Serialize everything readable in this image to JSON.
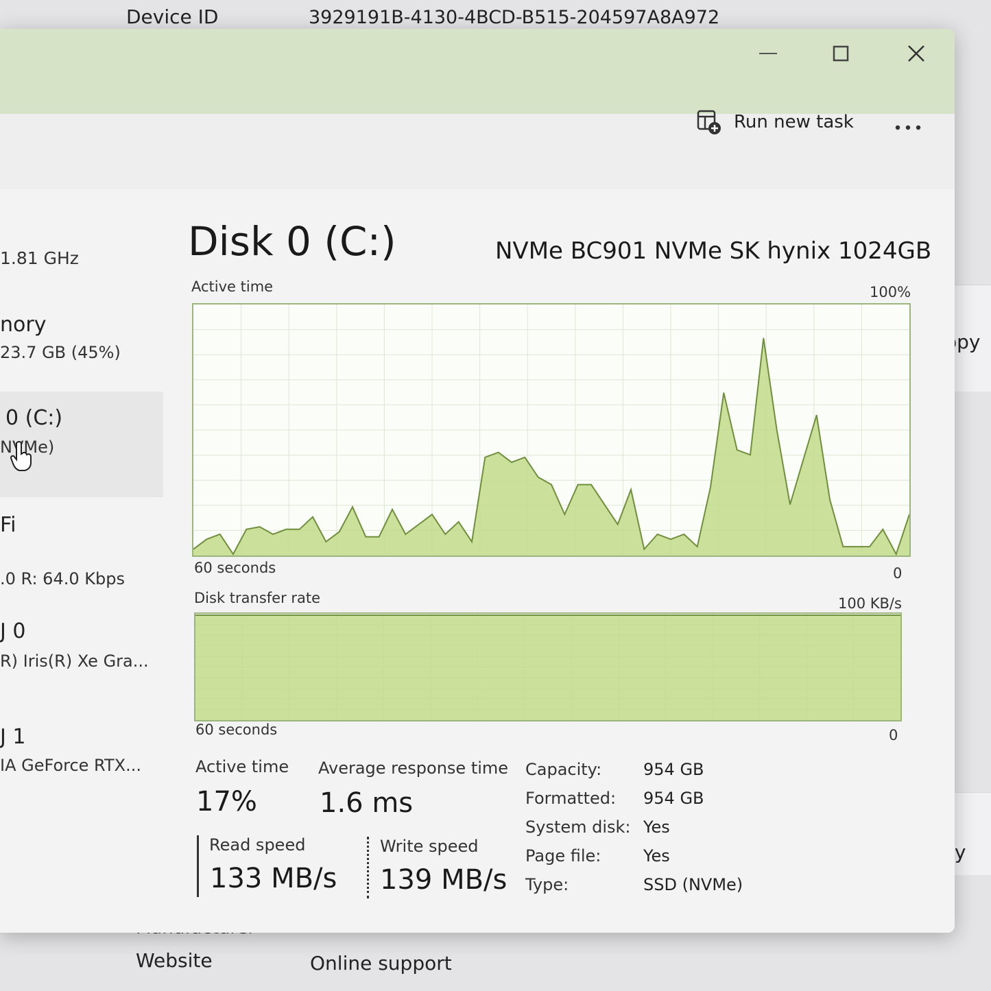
{
  "background_page": {
    "device_id_label": "Device ID",
    "device_id_value": "3929191B-4130-4BCD-B515-204597A8A972",
    "manufacturer_label": "Manufacturer",
    "website_label": "Website",
    "website_value": "Online support",
    "copy_label_1": "opy",
    "copy_label_2": "opy"
  },
  "window": {
    "buttons": {
      "minimize": "minimize",
      "maximize": "maximize",
      "close": "close"
    }
  },
  "toolbar": {
    "run_new_task": "Run new task",
    "more": "..."
  },
  "sidebar": {
    "cpu_speed": "1.81 GHz",
    "memory_title": "nory",
    "memory_usage": "23.7 GB (45%)",
    "disk_title": "0 (C:)",
    "disk_sub": "NVMe)",
    "wifi_title": "Fi",
    "wifi_sub": ".0 R: 64.0 Kbps",
    "gpu0_title": "J 0",
    "gpu0_sub": "R) Iris(R) Xe Gra...",
    "gpu1_title": "J 1",
    "gpu1_sub": "IA GeForce RTX..."
  },
  "main": {
    "title": "Disk 0 (C:)",
    "model": "NVMe BC901 NVMe SK hynix 1024GB",
    "active_graph": {
      "label": "Active time",
      "max": "100%",
      "xlabel": "60 seconds",
      "min": "0"
    },
    "transfer_graph": {
      "label": "Disk transfer rate",
      "max": "100 KB/s",
      "xlabel": "60 seconds",
      "min": "0"
    },
    "stats": {
      "active_time_label": "Active time",
      "active_time_value": "17%",
      "response_label": "Average response time",
      "response_value": "1.6 ms",
      "read_label": "Read speed",
      "read_value": "133 MB/s",
      "write_label": "Write speed",
      "write_value": "139 MB/s"
    },
    "info": [
      {
        "label": "Capacity:",
        "value": "954 GB"
      },
      {
        "label": "Formatted:",
        "value": "954 GB"
      },
      {
        "label": "System disk:",
        "value": "Yes"
      },
      {
        "label": "Page file:",
        "value": "Yes"
      },
      {
        "label": "Type:",
        "value": "SSD (NVMe)"
      }
    ]
  },
  "colors": {
    "accent_line": "#6f8f3c",
    "accent_fill": "#c2db8b",
    "titlebar": "#d7e3c6"
  },
  "chart_data": [
    {
      "type": "area",
      "title": "Active time",
      "ylabel": "%",
      "ylim": [
        0,
        100
      ],
      "x_label": "60 seconds",
      "values": [
        2,
        6,
        8,
        0,
        10,
        11,
        8,
        10,
        10,
        15,
        5,
        9,
        19,
        7,
        7,
        18,
        8,
        12,
        16,
        8,
        13,
        5,
        39,
        41,
        37,
        39,
        31,
        28,
        16,
        28,
        28,
        20,
        12,
        26,
        2,
        8,
        6,
        8,
        3,
        27,
        65,
        42,
        40,
        87,
        50,
        20,
        38,
        56,
        22,
        3,
        3,
        3,
        10,
        0,
        16
      ]
    },
    {
      "type": "area",
      "title": "Disk transfer rate",
      "ylabel": "KB/s",
      "ylim": [
        0,
        100
      ],
      "x_label": "60 seconds",
      "values": [
        100,
        100,
        100,
        100,
        100,
        100,
        100,
        100,
        100,
        100,
        100,
        100,
        100,
        100,
        100,
        100,
        100,
        100,
        100,
        100,
        100,
        100,
        100,
        100,
        100,
        100,
        100,
        100,
        100,
        100,
        100,
        100,
        100,
        100,
        100,
        100,
        100,
        100,
        100,
        100,
        100,
        100,
        100,
        100,
        100,
        100,
        100,
        100,
        100,
        100,
        100,
        100,
        100,
        100,
        100
      ]
    }
  ]
}
